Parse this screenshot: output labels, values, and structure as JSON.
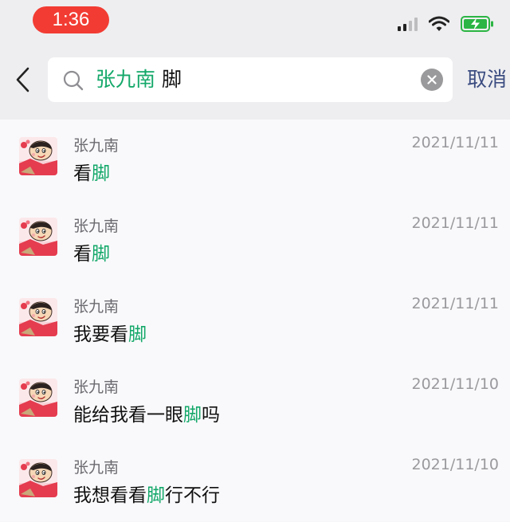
{
  "status_bar": {
    "time": "1:36",
    "icons": [
      "cellular-signal-icon",
      "wifi-icon",
      "battery-charging-icon"
    ],
    "time_pill_color": "#f23c33",
    "battery_color": "#2bb544"
  },
  "search": {
    "back_icon": "chevron-left-icon",
    "search_icon": "search-icon",
    "query_name": "张九南",
    "query_keyword": "脚",
    "clear_icon": "clear-icon",
    "cancel_label": "取消",
    "highlight_color": "#14a86a"
  },
  "results": [
    {
      "sender": "张九南",
      "date": "2021/11/11",
      "message_before": "看",
      "message_highlight": "脚",
      "message_after": ""
    },
    {
      "sender": "张九南",
      "date": "2021/11/11",
      "message_before": "看",
      "message_highlight": "脚",
      "message_after": ""
    },
    {
      "sender": "张九南",
      "date": "2021/11/11",
      "message_before": "我要看",
      "message_highlight": "脚",
      "message_after": ""
    },
    {
      "sender": "张九南",
      "date": "2021/11/10",
      "message_before": "能给我看一眼",
      "message_highlight": "脚",
      "message_after": "吗"
    },
    {
      "sender": "张九南",
      "date": "2021/11/10",
      "message_before": "我想看看",
      "message_highlight": "脚",
      "message_after": "行不行"
    }
  ]
}
